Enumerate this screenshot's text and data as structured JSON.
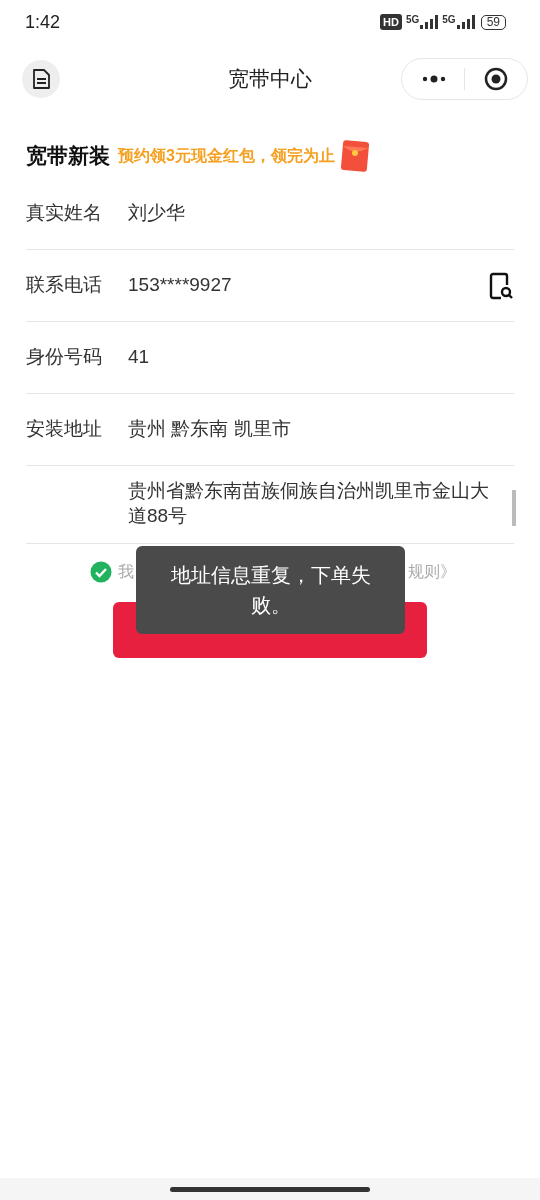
{
  "status_bar": {
    "time": "1:42",
    "hd_badge": "HD",
    "networks": [
      "5G",
      "5G"
    ],
    "battery": "59"
  },
  "nav_bar": {
    "title": "宽带中心"
  },
  "header": {
    "title": "宽带新装",
    "promo": "预约领3元现金红包，领完为止"
  },
  "form": [
    {
      "label": "真实姓名",
      "value": "刘少华"
    },
    {
      "label": "联系电话",
      "value": "153****9927",
      "kind": "phone"
    },
    {
      "label": "身份号码",
      "value": "41"
    },
    {
      "label": "安装地址",
      "value": "贵州 黔东南 凯里市"
    },
    {
      "value": "贵州省黔东南苗族侗族自治州凯里市金山大道88号",
      "kind": "multiline"
    }
  ],
  "agreement": {
    "checked": true,
    "text_parts": [
      "我",
      "规则》"
    ]
  },
  "toast": "地址信息重复，下单失败。"
}
